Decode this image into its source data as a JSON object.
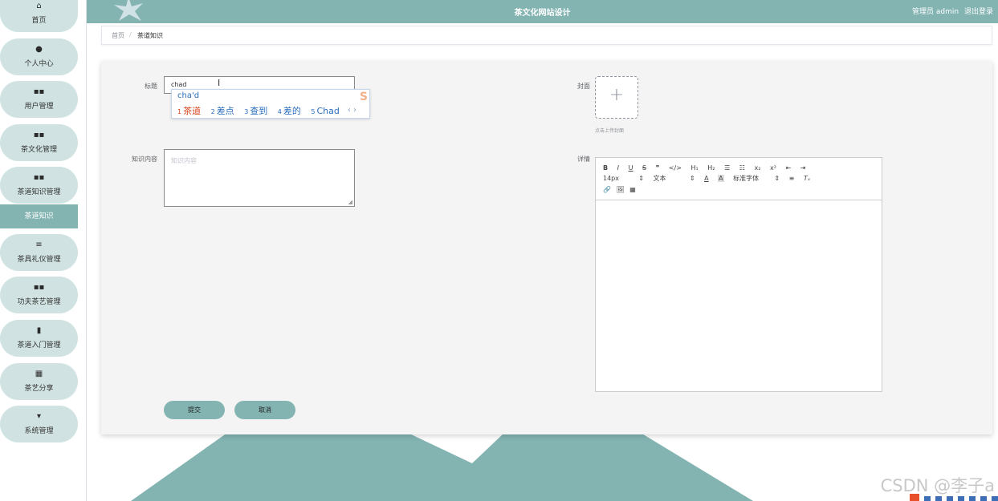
{
  "header": {
    "title": "茶文化网站设计",
    "admin_label": "管理员 admin",
    "logout_label": "退出登录"
  },
  "sidebar": {
    "items": [
      {
        "icon": "home-icon",
        "glyph": "⌂",
        "label": "首页"
      },
      {
        "icon": "user-icon",
        "glyph": "👤",
        "label": "个人中心"
      },
      {
        "icon": "grid-icon",
        "glyph": "▪▪",
        "label": "用户管理"
      },
      {
        "icon": "grid-icon",
        "glyph": "▪▪",
        "label": "茶文化管理"
      },
      {
        "icon": "grid-icon",
        "glyph": "▪▪",
        "label": "茶道知识管理"
      },
      {
        "icon": "list-icon",
        "glyph": "≡",
        "label": "茶具礼仪管理"
      },
      {
        "icon": "grid-icon",
        "glyph": "▪▪",
        "label": "功夫茶艺管理"
      },
      {
        "icon": "chart-icon",
        "glyph": "▮▮",
        "label": "茶道入门管理"
      },
      {
        "icon": "apps-icon",
        "glyph": "▦",
        "label": "茶艺分享"
      },
      {
        "icon": "settings-icon",
        "glyph": "▾",
        "label": "系统管理"
      }
    ],
    "active_sub": "茶道知识"
  },
  "breadcrumb": {
    "home": "首页",
    "separator": "/",
    "current": "茶道知识"
  },
  "form": {
    "title_label": "标题",
    "title_value": "chad",
    "content_label": "知识内容",
    "content_placeholder": "知识内容",
    "cover_label": "封面",
    "upload_tip": "点击上传封面",
    "detail_label": "详情",
    "submit_label": "提交",
    "cancel_label": "取消"
  },
  "ime": {
    "composition": "cha'd",
    "candidates": [
      {
        "num": "1",
        "text": "茶道"
      },
      {
        "num": "2",
        "text": "差点"
      },
      {
        "num": "3",
        "text": "查到"
      },
      {
        "num": "4",
        "text": "差的"
      },
      {
        "num": "5",
        "text": "Chad"
      }
    ],
    "arrows": "‹ ›"
  },
  "editor": {
    "toolbar_row1": [
      "B",
      "I",
      "U",
      "S",
      "❞",
      "</>",
      "H₁",
      "H₂",
      "☰",
      "☷",
      "x₂",
      "x²",
      "⇤",
      "⇥"
    ],
    "font_size": "14px",
    "header_select": "文本",
    "font_family": "标准字体",
    "toolbar_row3": [
      "🔗",
      "🖼",
      "▦"
    ]
  },
  "watermark": "CSDN @李子a",
  "colors": {
    "accent": "#83b4b2",
    "sidebar_item": "#d0e3e2",
    "ime_first": "#d9441b",
    "ime_other": "#2a6ebd"
  }
}
